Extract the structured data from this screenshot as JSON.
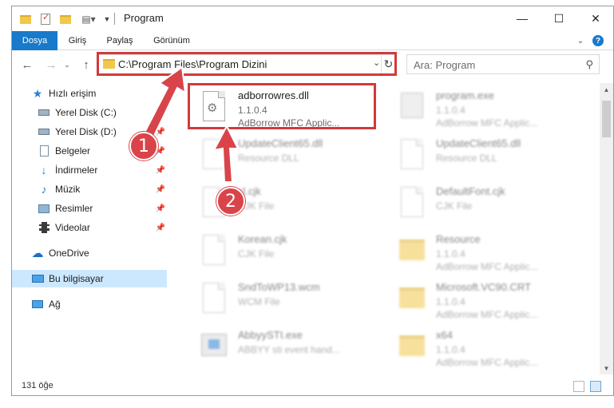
{
  "window": {
    "title": "Program",
    "minimize": "—",
    "maximize": "☐",
    "close": "✕"
  },
  "ribbon": {
    "tabs": [
      "Dosya",
      "Giriş",
      "Paylaş",
      "Görünüm"
    ]
  },
  "address": {
    "path": "C:\\Program Files\\Program Dizini",
    "search_placeholder": "Ara: Program"
  },
  "nav": {
    "items": [
      {
        "label": "Hızlı erişim"
      },
      {
        "label": "Yerel Disk (C:)"
      },
      {
        "label": "Yerel Disk (D:)"
      },
      {
        "label": "Belgeler"
      },
      {
        "label": "İndirmeler"
      },
      {
        "label": "Müzik"
      },
      {
        "label": "Resimler"
      },
      {
        "label": "Videolar"
      },
      {
        "label": "OneDrive"
      },
      {
        "label": "Bu bilgisayar"
      },
      {
        "label": "Ağ"
      }
    ]
  },
  "files": [
    {
      "name": "adborrowres.dll",
      "line1": "1.1.0.4",
      "line2": "AdBorrow MFC Applic..."
    },
    {
      "name": "program.exe",
      "line1": "1.1.0.4",
      "line2": "AdBorrow MFC Applic..."
    },
    {
      "name": "UpdateClient65.dll",
      "line1": "Resource DLL",
      "line2": ""
    },
    {
      "name": "UpdateClient65.dll",
      "line1": "Resource DLL",
      "line2": ""
    },
    {
      "name": "cl.cjk",
      "line1": "CJK File",
      "line2": ""
    },
    {
      "name": "DefaultFont.cjk",
      "line1": "CJK File",
      "line2": ""
    },
    {
      "name": "Korean.cjk",
      "line1": "CJK File",
      "line2": ""
    },
    {
      "name": "Resource",
      "line1": "1.1.0.4",
      "line2": "AdBorrow MFC Applic..."
    },
    {
      "name": "SndToWP13.wcm",
      "line1": "WCM File",
      "line2": ""
    },
    {
      "name": "Microsoft.VC90.CRT",
      "line1": "1.1.0.4",
      "line2": "AdBorrow MFC Applic..."
    },
    {
      "name": "AbbyySTI.exe",
      "line1": "ABBYY sti event hand...",
      "line2": ""
    },
    {
      "name": "x64",
      "line1": "1.1.0.4",
      "line2": "AdBorrow MFC Applic..."
    }
  ],
  "status": {
    "count": "131 öğe"
  },
  "annotations": {
    "badge1": "1",
    "badge2": "2",
    "color": "#d23a3a"
  }
}
